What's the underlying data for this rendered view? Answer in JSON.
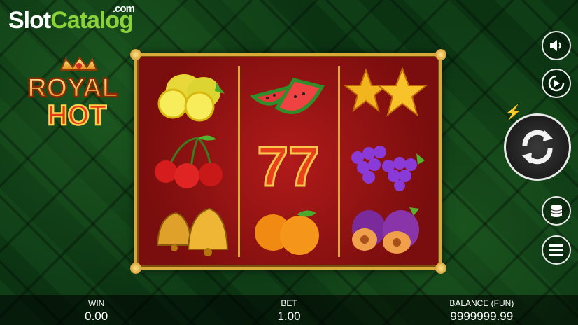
{
  "branding": {
    "site_part1": "Slot",
    "site_part2": "Catalog",
    "site_suffix": ".com",
    "game_line1": "ROYAL",
    "game_line2": "HOT"
  },
  "reels": [
    [
      "lemon",
      "watermelon",
      "star"
    ],
    [
      "cherry",
      "seven",
      "grapes"
    ],
    [
      "bell",
      "orange",
      "plum"
    ]
  ],
  "controls": {
    "sound_icon": "speaker-icon",
    "autoplay_icon": "play-circle-icon",
    "turbo_icon": "lightning-icon",
    "spin_icon": "spin-arrows-icon",
    "bet_icon": "coin-stack-icon",
    "menu_icon": "hamburger-menu-icon"
  },
  "bottom_bar": {
    "win_label": "WIN",
    "win_value": "0.00",
    "bet_label": "BET",
    "bet_value": "1.00",
    "balance_label": "BALANCE (FUN)",
    "balance_value": "9999999.99"
  },
  "colors": {
    "frame_gold": "#d9a93a",
    "reel_red": "#9a1212",
    "background_green": "#0e3a15",
    "brand_green": "#8bd13a"
  }
}
